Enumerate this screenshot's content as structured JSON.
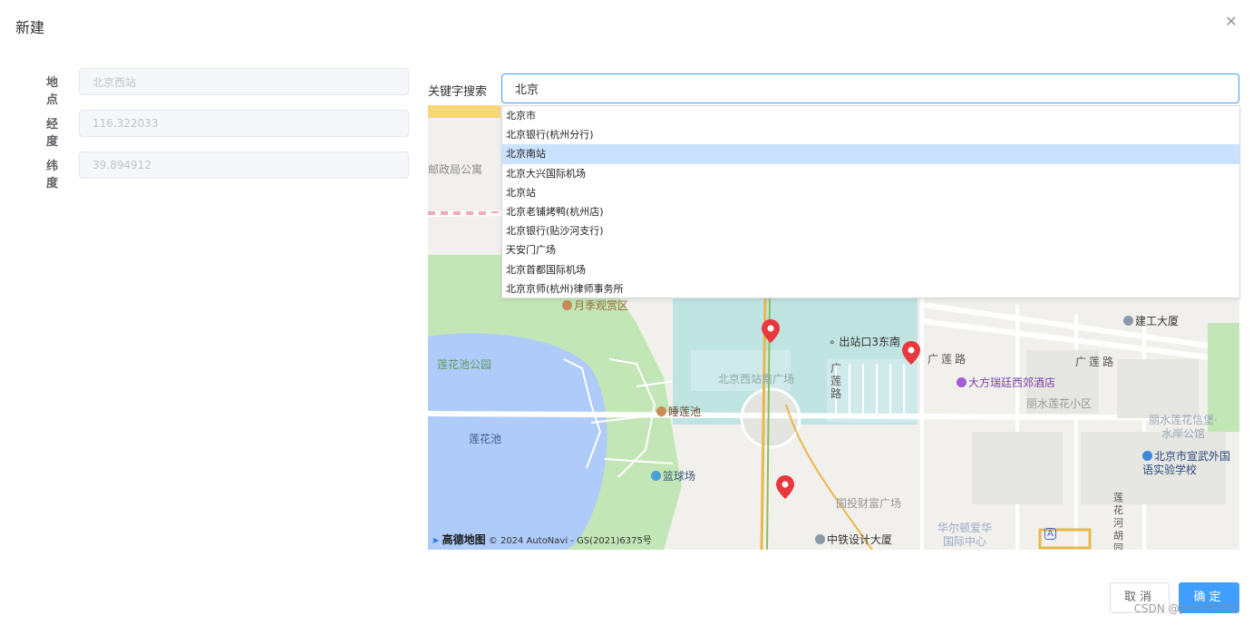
{
  "dialog": {
    "title": "新建",
    "close_icon": "close-icon"
  },
  "form": {
    "fields": [
      {
        "label": "地点",
        "value": "北京西站"
      },
      {
        "label": "经度",
        "value": "116.322033"
      },
      {
        "label": "纬度",
        "value": "39.894912"
      }
    ]
  },
  "search": {
    "label": "关键字搜索",
    "value": "北京"
  },
  "suggestions": {
    "active_index": 2,
    "items": [
      "北京市",
      "北京银行(杭州分行)",
      "北京南站",
      "北京大兴国际机场",
      "北京站",
      "北京老铺烤鸭(杭州店)",
      "北京银行(贴沙河支行)",
      "天安门广场",
      "北京首都国际机场",
      "北京京师(杭州)律师事务所"
    ]
  },
  "map": {
    "labels": {
      "post_apartment": "邮政局公寓",
      "yueji": "月季观赏区",
      "lianhuachi_park": "莲花池公园",
      "lianhuachi": "莲花池",
      "shuilianchi": "睡莲池",
      "basketball": "篮球场",
      "west_station_square": "北京西站南广场",
      "exit3": "出站口3东南",
      "guanglian_road_v": "广莲路",
      "guanglian_road_1": "广莲路",
      "guanglian_road_2": "广莲路",
      "fangti_hotel": "大方瑞廷西郊酒店",
      "lishui": "丽水莲花小区",
      "jiangong": "建工大厦",
      "lishui_castle": "丽水莲花信堡·水岸公馆",
      "school": "北京市宣武外国语实验学校",
      "guotou": "国投财富广场",
      "zhongtie": "中铁设计大厦",
      "washington": "华尔顿爱华国际中心",
      "lianhuahe": "莲花河胡同",
      "metro": "A"
    },
    "brand": "高德地图",
    "attribution": "© 2024 AutoNavi - GS(2021)6375号",
    "colors": {
      "water": "#aecbfa",
      "park": "#c3e6b6",
      "station": "#bfe4e2",
      "marker": "#e8383d"
    }
  },
  "buttons": {
    "cancel": "取消",
    "ok": "确定"
  },
  "watermark": "CSDN @proud1212",
  "colors": {
    "primary": "#409eff",
    "active_suggestion": "#cae1ff"
  }
}
